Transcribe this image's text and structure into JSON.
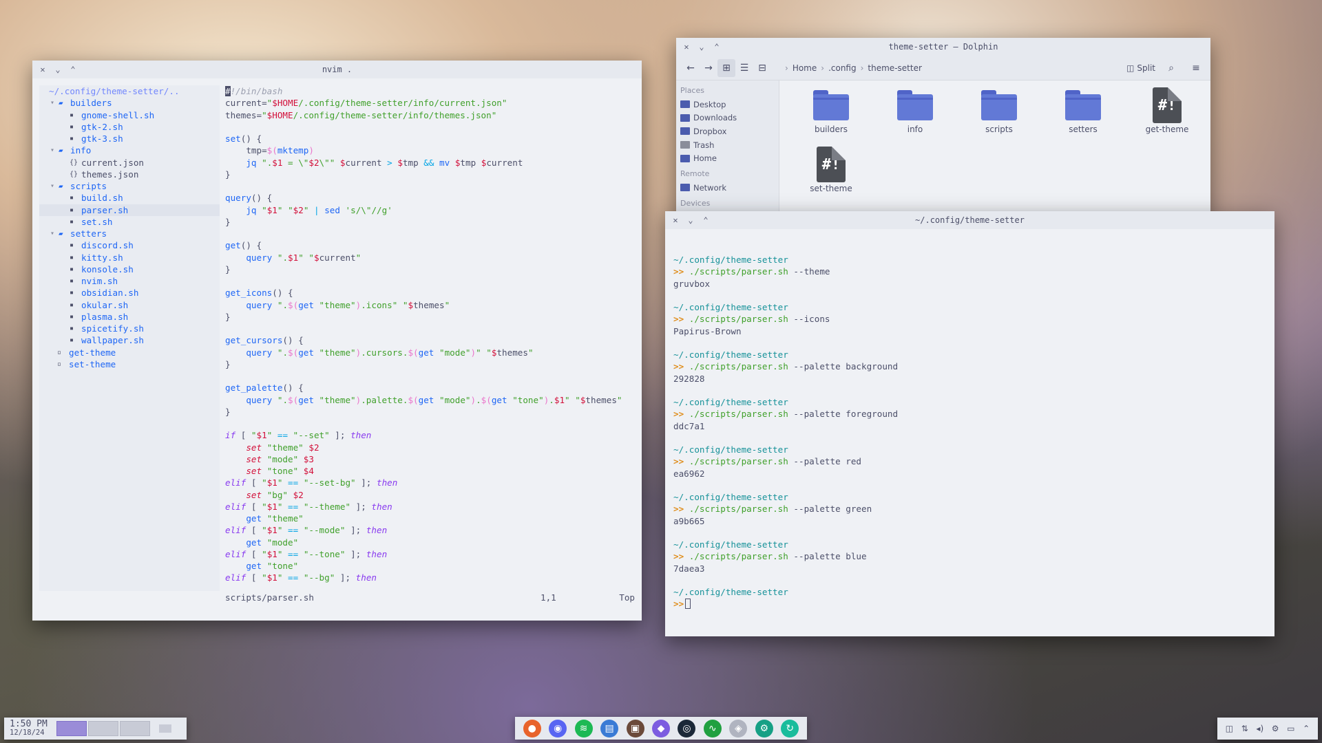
{
  "nvim": {
    "title": "nvim .",
    "tree": {
      "root": "~/.config/theme-setter/..",
      "builders": {
        "label": "builders",
        "files": [
          "gnome-shell.sh",
          "gtk-2.sh",
          "gtk-3.sh"
        ]
      },
      "info": {
        "label": "info",
        "files": [
          "current.json",
          "themes.json"
        ]
      },
      "scripts": {
        "label": "scripts",
        "files": [
          "build.sh",
          "parser.sh",
          "set.sh"
        ]
      },
      "setters": {
        "label": "setters",
        "files": [
          "discord.sh",
          "kitty.sh",
          "konsole.sh",
          "nvim.sh",
          "obsidian.sh",
          "okular.sh",
          "plasma.sh",
          "spicetify.sh",
          "wallpaper.sh"
        ]
      },
      "root_files": [
        "get-theme",
        "set-theme"
      ]
    },
    "status": {
      "file": "scripts/parser.sh",
      "position": "1,1",
      "scroll": "Top"
    }
  },
  "dolphin": {
    "title": "theme-setter — Dolphin",
    "breadcrumb": [
      "Home",
      ".config",
      "theme-setter"
    ],
    "split_label": "Split",
    "places_header": "Places",
    "places": [
      "Desktop",
      "Downloads",
      "Dropbox",
      "Trash",
      "Home"
    ],
    "remote_header": "Remote",
    "remote": [
      "Network"
    ],
    "devices_header": "Devices",
    "items": [
      {
        "name": "builders",
        "kind": "folder"
      },
      {
        "name": "info",
        "kind": "folder"
      },
      {
        "name": "scripts",
        "kind": "folder"
      },
      {
        "name": "setters",
        "kind": "folder"
      },
      {
        "name": "get-theme",
        "kind": "script"
      },
      {
        "name": "set-theme",
        "kind": "script"
      }
    ],
    "script_glyph": "#!"
  },
  "terminal": {
    "title": "~/.config/theme-setter",
    "prompt_path": "~/.config/theme-setter",
    "prompt_symbol": ">>",
    "entries": [
      {
        "cmd": "./scripts/parser.sh",
        "args": "--theme",
        "out": "gruvbox"
      },
      {
        "cmd": "./scripts/parser.sh",
        "args": "--icons",
        "out": "Papirus-Brown"
      },
      {
        "cmd": "./scripts/parser.sh",
        "args": "--palette background",
        "out": "292828"
      },
      {
        "cmd": "./scripts/parser.sh",
        "args": "--palette foreground",
        "out": "ddc7a1"
      },
      {
        "cmd": "./scripts/parser.sh",
        "args": "--palette red",
        "out": "ea6962"
      },
      {
        "cmd": "./scripts/parser.sh",
        "args": "--palette green",
        "out": "a9b665"
      },
      {
        "cmd": "./scripts/parser.sh",
        "args": "--palette blue",
        "out": "7daea3"
      }
    ]
  },
  "panel": {
    "time": "1:50 PM",
    "date": "12/18/24"
  },
  "dock": {
    "apps": [
      {
        "name": "firefox-icon",
        "glyph": "●",
        "color": "#e8632b"
      },
      {
        "name": "discord-icon",
        "glyph": "◉",
        "color": "#5865f2"
      },
      {
        "name": "spotify-icon",
        "glyph": "≋",
        "color": "#1db954"
      },
      {
        "name": "dolphin-icon",
        "glyph": "▤",
        "color": "#3a7bd5"
      },
      {
        "name": "terminal-icon",
        "glyph": "▣",
        "color": "#6b4a3a"
      },
      {
        "name": "obsidian-icon",
        "glyph": "◆",
        "color": "#7c5ce0"
      },
      {
        "name": "steam-icon",
        "glyph": "◎",
        "color": "#1b2838"
      },
      {
        "name": "monitor-icon",
        "glyph": "∿",
        "color": "#20a040"
      },
      {
        "name": "shield-icon",
        "glyph": "◈",
        "color": "#b0b4c0"
      },
      {
        "name": "settings-icon",
        "glyph": "⚙",
        "color": "#16a085"
      },
      {
        "name": "sync-icon",
        "glyph": "↻",
        "color": "#1abc9c"
      }
    ]
  },
  "tray": [
    "discord-tray-icon",
    "network-icon",
    "volume-icon",
    "settings-icon",
    "display-icon",
    "chevron-up-icon"
  ]
}
